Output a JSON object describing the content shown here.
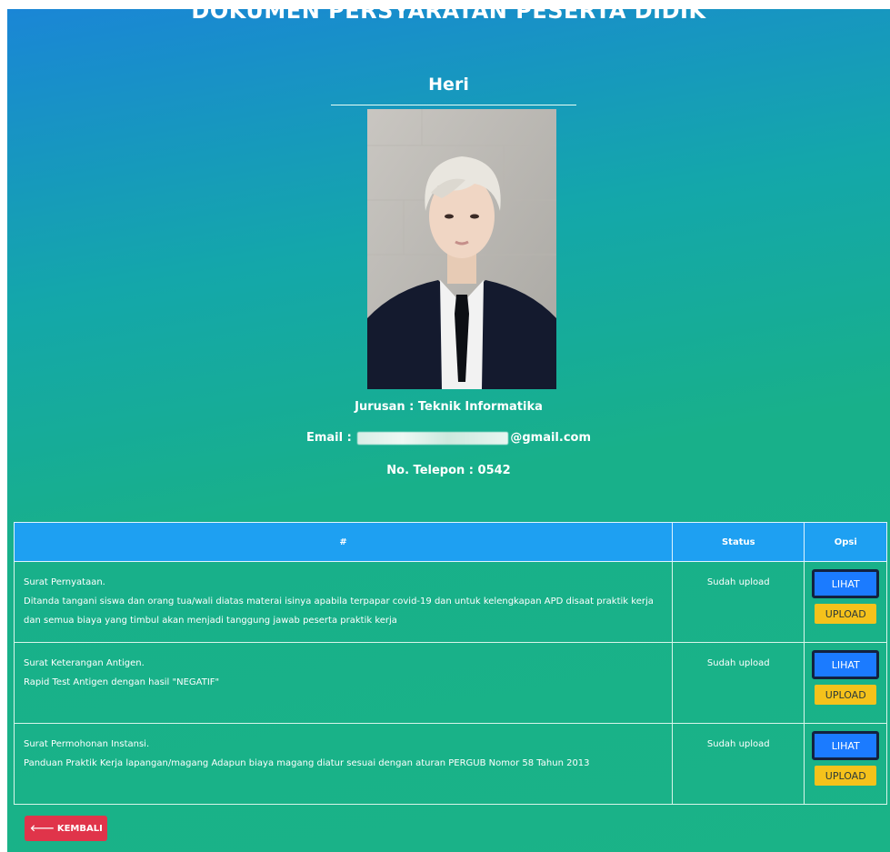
{
  "page": {
    "heading": "DOKUMEN PERSYARATAN PESERTA DIDIK",
    "student_name": "Heri"
  },
  "profile": {
    "jurusan": "Jurusan : Teknik Informatika",
    "email_label": "Email :",
    "email_domain": "@gmail.com",
    "phone": "No. Telepon : 0542"
  },
  "table": {
    "headers": [
      "#",
      "Status",
      "Opsi"
    ],
    "rows": [
      {
        "title": "Surat Pernyataan.",
        "description": "Ditanda tangani siswa dan orang tua/wali diatas materai isinya apabila terpapar covid-19 dan untuk kelengkapan APD disaat praktik kerja dan semua biaya yang timbul akan menjadi tanggung jawab peserta praktik kerja",
        "status": "Sudah upload",
        "view_label": "LIHAT",
        "upload_label": "UPLOAD"
      },
      {
        "title": "Surat Keterangan Antigen.",
        "description": "Rapid Test Antigen dengan hasil \"NEGATIF\"",
        "status": "Sudah upload",
        "view_label": "LIHAT",
        "upload_label": "UPLOAD"
      },
      {
        "title": "Surat Permohonan Instansi.",
        "description": "Panduan Praktik Kerja lapangan/magang Adapun biaya magang diatur sesuai dengan aturan PERGUB Nomor 58 Tahun 2013",
        "status": "Sudah upload",
        "view_label": "LIHAT",
        "upload_label": "UPLOAD"
      }
    ]
  },
  "back_button": {
    "label": "KEMBALI",
    "icon": "arrow-left-icon"
  },
  "colors": {
    "header_bg": "#1ea0f2",
    "lihat_bg": "#1b7bff",
    "upload_bg": "#f5c21b",
    "back_bg": "#e0344a"
  }
}
